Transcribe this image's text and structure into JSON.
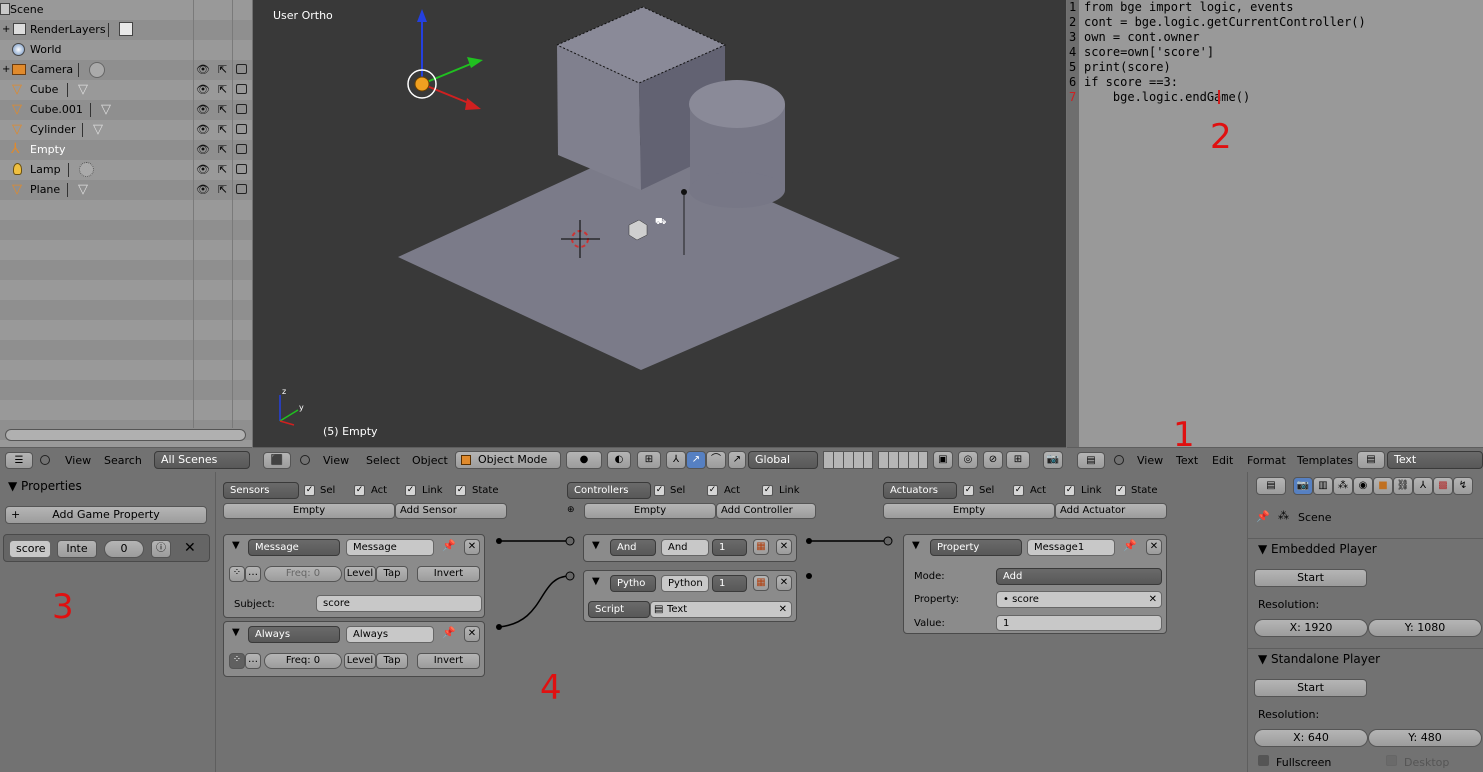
{
  "outliner": {
    "items": [
      {
        "name": "Scene",
        "icon": "scene-icon"
      },
      {
        "name": "RenderLayers",
        "icon": "render-layers-icon"
      },
      {
        "name": "World",
        "icon": "world-icon"
      },
      {
        "name": "Camera",
        "icon": "camera-icon"
      },
      {
        "name": "Cube",
        "icon": "mesh-icon"
      },
      {
        "name": "Cube.001",
        "icon": "mesh-icon"
      },
      {
        "name": "Cylinder",
        "icon": "mesh-icon"
      },
      {
        "name": "Empty",
        "icon": "empty-icon"
      },
      {
        "name": "Lamp",
        "icon": "lamp-icon"
      },
      {
        "name": "Plane",
        "icon": "mesh-icon"
      }
    ],
    "header": {
      "view": "View",
      "search": "Search",
      "scenes": "All Scenes"
    }
  },
  "viewport": {
    "view_label": "User Ortho",
    "object_label": "(5) Empty",
    "header": {
      "view": "View",
      "select": "Select",
      "object": "Object",
      "mode": "Object Mode",
      "orientation": "Global"
    }
  },
  "text_editor": {
    "lines": [
      {
        "num": "1",
        "text": "from bge import logic, events"
      },
      {
        "num": "2",
        "text": "cont = bge.logic.getCurrentController()"
      },
      {
        "num": "3",
        "text": "own = cont.owner"
      },
      {
        "num": "4",
        "text": "score=own['score']"
      },
      {
        "num": "5",
        "text": "print(score)"
      },
      {
        "num": "6",
        "text": "if score ==3:"
      },
      {
        "num": "7",
        "text": "    bge.logic.endGame()"
      }
    ],
    "header": {
      "view": "View",
      "text": "Text",
      "edit": "Edit",
      "format": "Format",
      "templates": "Templates",
      "datablock": "Text"
    }
  },
  "annotations": {
    "one": "1",
    "two": "2",
    "three": "3",
    "four": "4"
  },
  "properties_panel": {
    "title": "Properties",
    "add_button": "Add Game Property",
    "prop_name": "score",
    "prop_type": "Inte",
    "prop_value": "0"
  },
  "logic": {
    "sensors": {
      "dropdown": "Sensors",
      "sel": "Sel",
      "act": "Act",
      "link": "Link",
      "state": "State",
      "object": "Empty",
      "add": "Add Sensor",
      "message": {
        "type": "Message",
        "name": "Message",
        "freq": "Freq: 0",
        "level": "Level",
        "tap": "Tap",
        "invert": "Invert",
        "subject_label": "Subject:",
        "subject": "score"
      },
      "always": {
        "type": "Always",
        "name": "Always",
        "freq": "Freq: 0",
        "level": "Level",
        "tap": "Tap",
        "invert": "Invert"
      }
    },
    "controllers": {
      "dropdown": "Controllers",
      "sel": "Sel",
      "act": "Act",
      "link": "Link",
      "object": "Empty",
      "add": "Add Controller",
      "and": {
        "type": "And",
        "name": "And",
        "state": "1"
      },
      "python": {
        "type": "Pytho",
        "name": "Python",
        "state": "1",
        "mode": "Script",
        "text": "Text"
      }
    },
    "actuators": {
      "dropdown": "Actuators",
      "sel": "Sel",
      "act": "Act",
      "link": "Link",
      "state": "State",
      "object": "Empty",
      "add": "Add Actuator",
      "property": {
        "type": "Property",
        "name": "Message1",
        "mode_label": "Mode:",
        "mode": "Add",
        "property_label": "Property:",
        "property": "score",
        "value_label": "Value:",
        "value": "1"
      }
    }
  },
  "render_props": {
    "scene": "Scene",
    "embedded": {
      "title": "Embedded Player",
      "start": "Start",
      "resolution": "Resolution:",
      "x": "X: 1920",
      "y": "Y: 1080"
    },
    "standalone": {
      "title": "Standalone Player",
      "start": "Start",
      "resolution": "Resolution:",
      "x": "X: 640",
      "y": "Y: 480",
      "fullscreen": "Fullscreen",
      "desktop": "Desktop"
    }
  }
}
